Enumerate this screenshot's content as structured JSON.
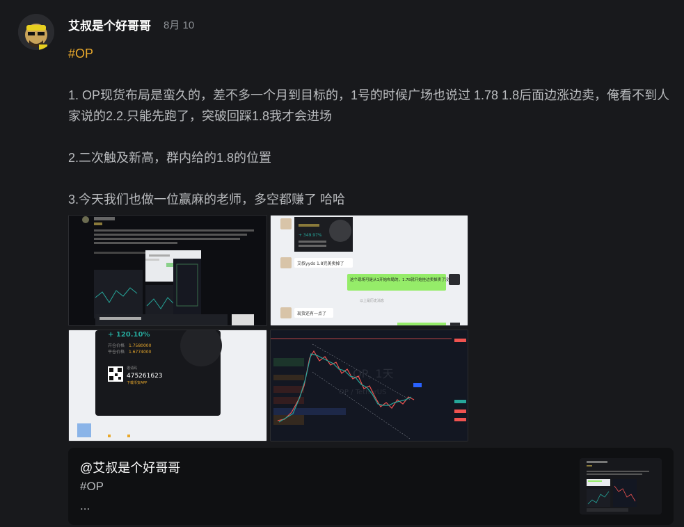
{
  "post": {
    "author": "艾叔是个好哥哥",
    "date": "8月 10",
    "tag": "#OP",
    "paragraphs": [
      "1. OP现货布局是蛮久的，差不多一个月到目标的，1号的时候广场也说过 1.78 1.8后面边涨边卖，俺看不到人家说的2.2.只能先跑了，突破回踩1.8我才会进场",
      "2.二次触及新高，群内给的1.8的位置",
      "3.今天我们也做一位赢麻的老师，多空都赚了 哈哈"
    ]
  },
  "images": {
    "chat": {
      "message1": "艾叔yyds 1.8完美卖掉了",
      "message2": "这个现场可是从1开始布局的，1.78就开始挂边卖掉卖了没",
      "system_note": "以上是历史消息",
      "message3": "现货还有一点了",
      "card_pct": "+ 349.97%"
    },
    "share_card": {
      "gain": "+ 120.10%",
      "open_label": "开仓价格",
      "open_value": "1.7580000",
      "close_label": "平仓价格",
      "close_value": "1.6774000",
      "code_label": "邀请码",
      "code_value": "475261623",
      "download_label": "下载币安APP"
    },
    "chart": {
      "watermark": "OP, 1天",
      "pair": "OP / TetherUS"
    }
  },
  "quote": {
    "author": "@艾叔是个好哥哥",
    "tag": "#OP",
    "ellipsis": "..."
  },
  "colors": {
    "tag": "#e8a82b",
    "up": "#26a69a",
    "down": "#ef5350"
  }
}
